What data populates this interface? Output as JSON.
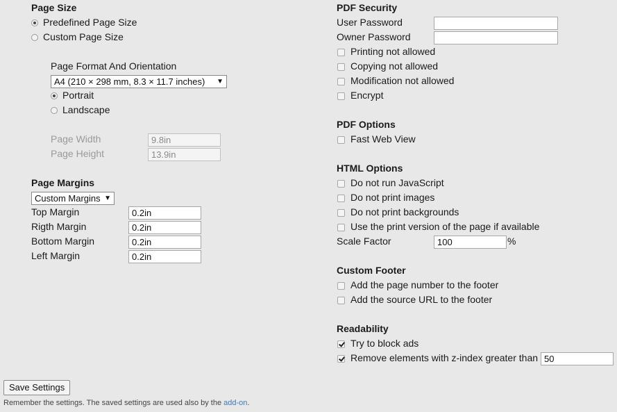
{
  "page_size": {
    "heading": "Page Size",
    "predefined_label": "Predefined Page Size",
    "custom_label": "Custom Page Size",
    "format_heading": "Page Format And Orientation",
    "format_value": "A4 (210 × 298 mm, 8.3 × 11.7 inches)",
    "portrait_label": "Portrait",
    "landscape_label": "Landscape",
    "width_label": "Page Width",
    "width_value": "9.8in",
    "height_label": "Page Height",
    "height_value": "13.9in",
    "selected_size": "Predefined Page Size",
    "selected_orientation": "Portrait"
  },
  "page_margins": {
    "heading": "Page Margins",
    "mode_value": "Custom Margins",
    "top_label": "Top Margin",
    "top_value": "0.2in",
    "right_label": "Rigth Margin",
    "right_value": "0.2in",
    "bottom_label": "Bottom Margin",
    "bottom_value": "0.2in",
    "left_label": "Left Margin",
    "left_value": "0.2in"
  },
  "pdf_security": {
    "heading": "PDF Security",
    "user_password_label": "User Password",
    "user_password_value": "",
    "owner_password_label": "Owner Password",
    "owner_password_value": "",
    "printing_label": "Printing not allowed",
    "copying_label": "Copying not allowed",
    "modification_label": "Modification not allowed",
    "encrypt_label": "Encrypt"
  },
  "pdf_options": {
    "heading": "PDF Options",
    "fast_web_view_label": "Fast Web View"
  },
  "html_options": {
    "heading": "HTML Options",
    "no_js_label": "Do not run JavaScript",
    "no_images_label": "Do not print images",
    "no_backgrounds_label": "Do not print backgrounds",
    "print_version_label": "Use the print version of the page if available",
    "scale_label": "Scale Factor",
    "scale_value": "100",
    "scale_unit": "%"
  },
  "custom_footer": {
    "heading": "Custom Footer",
    "page_number_label": "Add the page number to the footer",
    "source_url_label": "Add the source URL to the footer"
  },
  "readability": {
    "heading": "Readability",
    "block_ads_label": "Try to block ads",
    "block_ads_checked": true,
    "zindex_label": "Remove elements with z-index greater than",
    "zindex_checked": true,
    "zindex_value": "50"
  },
  "footer": {
    "save_label": "Save Settings",
    "note_text": "Remember the settings. The saved settings are used also by the ",
    "note_link": "add-on",
    "note_end": "."
  }
}
